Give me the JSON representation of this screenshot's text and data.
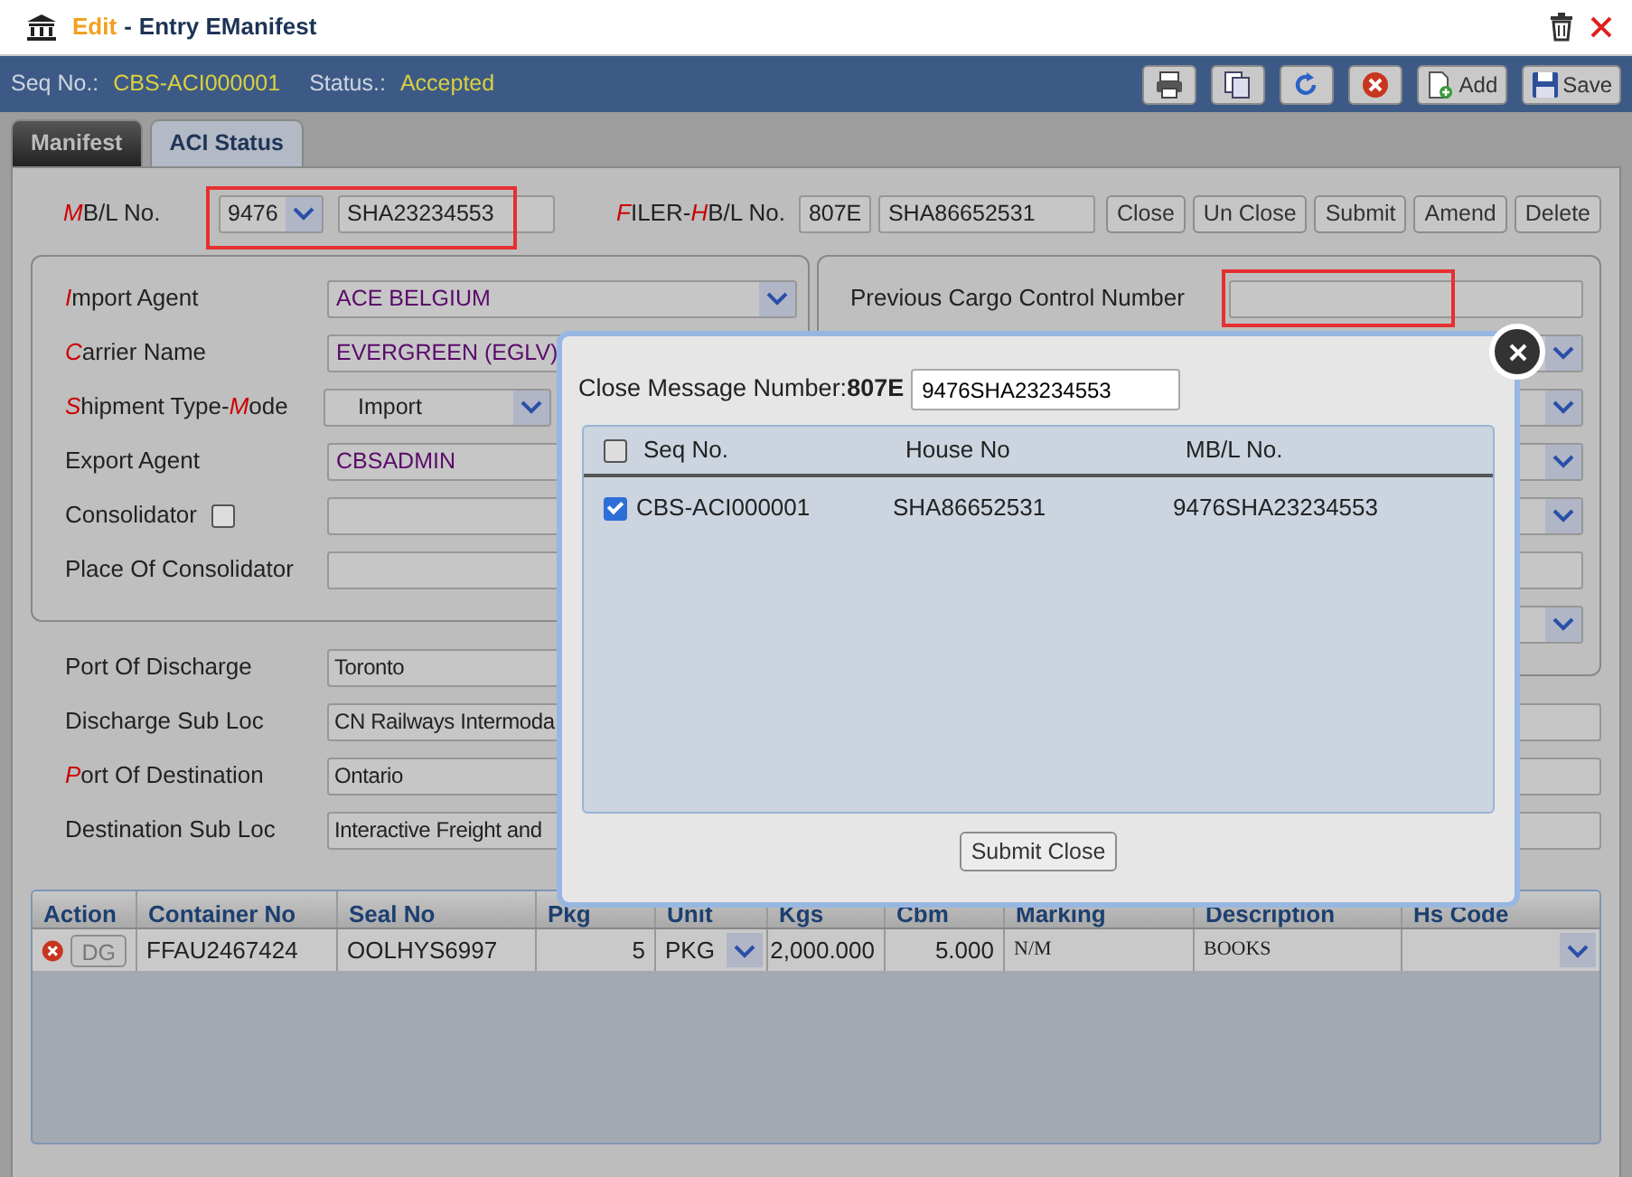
{
  "window": {
    "mode": "Edit",
    "separator": "-",
    "title": "Entry EManifest"
  },
  "header": {
    "seq_label": "Seq No.:",
    "seq_value": "CBS-ACI000001",
    "status_label": "Status.:",
    "status_value": "Accepted",
    "button_labels": [
      "Add",
      "Save"
    ]
  },
  "tabs": [
    {
      "label": "Manifest",
      "selected": false
    },
    {
      "label": "ACI Status",
      "selected": true
    }
  ],
  "mbl": {
    "label": [
      {
        "text": "M",
        "required": true
      },
      {
        "text": "B/L No.",
        "required": false
      }
    ],
    "prefix": "9476",
    "value": "SHA23234553",
    "highlighted": true
  },
  "filer": {
    "label": [
      {
        "text": "F",
        "required": true
      },
      {
        "text": "ILER-",
        "required": false
      },
      {
        "text": "H",
        "required": true
      },
      {
        "text": "B/L No.",
        "required": false
      }
    ],
    "prefix": "807E",
    "value": "SHA86652531"
  },
  "actions": [
    "Close",
    "Un Close",
    "Submit",
    "Amend",
    "Delete"
  ],
  "left_panel": [
    {
      "kind": "lookup_select",
      "label": [
        {
          "text": "I",
          "required": true
        },
        {
          "text": "mport Agent",
          "required": false
        }
      ],
      "value": "ACE BELGIUM"
    },
    {
      "kind": "lookup",
      "label": [
        {
          "text": "C",
          "required": true
        },
        {
          "text": "arrier Name",
          "required": false
        }
      ],
      "value": "EVERGREEN (EGLV)"
    },
    {
      "kind": "select",
      "label": [
        {
          "text": "S",
          "required": true
        },
        {
          "text": "hipment Type-",
          "required": false
        },
        {
          "text": "M",
          "required": true
        },
        {
          "text": "ode",
          "required": false
        }
      ],
      "value": "Import"
    },
    {
      "kind": "lookup",
      "label": [
        {
          "text": "Export Agent",
          "required": false
        }
      ],
      "value": "CBSADMIN"
    },
    {
      "kind": "checkbox_text",
      "label": [
        {
          "text": "Consolidator",
          "required": false
        }
      ],
      "checked": false
    },
    {
      "kind": "text",
      "label": [
        {
          "text": "Place Of Consolidator",
          "required": false
        }
      ]
    }
  ],
  "right_panel": {
    "label": "Previous Cargo Control Number",
    "highlighted": true,
    "rows": [
      {
        "kind": "select"
      },
      {
        "kind": "select"
      },
      {
        "kind": "select"
      },
      {
        "kind": "select"
      },
      {
        "kind": "text"
      },
      {
        "kind": "select"
      }
    ]
  },
  "lower_rows": [
    {
      "label": [
        {
          "text": "Port Of Discharge",
          "required": false
        }
      ],
      "value": "Toronto",
      "right_field": false
    },
    {
      "label": [
        {
          "text": "Discharge Sub Loc",
          "required": false
        }
      ],
      "value": "CN Railways Intermoda",
      "right_field": true
    },
    {
      "label": [
        {
          "text": "P",
          "required": true
        },
        {
          "text": "ort Of Destination",
          "required": false
        }
      ],
      "value": "Ontario",
      "right_field": true
    },
    {
      "label": [
        {
          "text": "Destination Sub Loc",
          "required": false
        }
      ],
      "value": "Interactive Freight and",
      "right_field": true
    }
  ],
  "grid": {
    "columns": [
      "Action",
      "Container No",
      "Seal No",
      "Pkg",
      "Unit",
      "Kgs",
      "Cbm",
      "Marking",
      "Description",
      "Hs Code"
    ],
    "rows": [
      [
        {
          "kind": "action",
          "label": "DG"
        },
        {
          "kind": "text",
          "value": "FFAU2467424"
        },
        {
          "kind": "text",
          "value": "OOLHYS6997"
        },
        {
          "kind": "number",
          "value": "5"
        },
        {
          "kind": "select",
          "value": "PKG"
        },
        {
          "kind": "number",
          "value": "2,000.000"
        },
        {
          "kind": "number",
          "value": "5.000"
        },
        {
          "kind": "mono",
          "value": "N/M"
        },
        {
          "kind": "mono",
          "value": "BOOKS"
        },
        {
          "kind": "select"
        }
      ]
    ]
  },
  "dialog": {
    "label": "Close Message Number:**807E**",
    "value": "9476SHA23234553",
    "columns": [
      "Seq No.",
      "House No",
      "MB/L No."
    ],
    "all_checked": false,
    "rows": [
      {
        "checked": true,
        "cells": [
          "CBS-ACI000001",
          "SHA86652531",
          "9476SHA23234553"
        ]
      }
    ],
    "button": "Submit Close"
  }
}
